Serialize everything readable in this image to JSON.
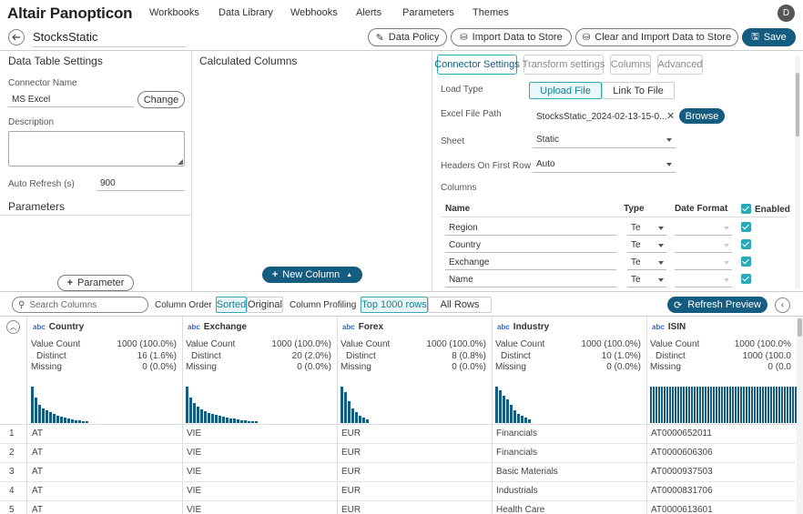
{
  "app": {
    "logo": "Altair Panopticon",
    "user_initial": "D"
  },
  "nav": [
    "Workbooks",
    "Data Library",
    "Webhooks",
    "Alerts",
    "Parameters",
    "Themes"
  ],
  "title": "StocksStatic",
  "actions": {
    "data_policy": "Data Policy",
    "import": "Import Data to Store",
    "clear_import": "Clear and Import Data to Store",
    "save": "Save"
  },
  "left": {
    "heading": "Data Table Settings",
    "connector_label": "Connector Name",
    "connector_value": "MS Excel",
    "change": "Change",
    "description_label": "Description",
    "autorefresh_label": "Auto Refresh (s)",
    "autorefresh_value": "900",
    "params_heading": "Parameters",
    "add_param": "Parameter"
  },
  "calc": {
    "heading": "Calculated Columns",
    "new_column": "New Column"
  },
  "right": {
    "tabs": [
      "Connector Settings",
      "Transform settings",
      "Columns",
      "Advanced"
    ],
    "load_type_label": "Load Type",
    "load_options": [
      "Upload File",
      "Link To File"
    ],
    "file_path_label": "Excel File Path",
    "file_path_value": "StocksStatic_2024-02-13-15-0...",
    "browse": "Browse",
    "sheet_label": "Sheet",
    "sheet_value": "Static",
    "headers_label": "Headers On First Row",
    "headers_value": "Auto",
    "columns_label": "Columns",
    "col_headers": {
      "name": "Name",
      "type": "Type",
      "date_format": "Date Format",
      "enabled": "Enabled"
    },
    "rows": [
      {
        "name": "Region",
        "type": "Te"
      },
      {
        "name": "Country",
        "type": "Te"
      },
      {
        "name": "Exchange",
        "type": "Te"
      },
      {
        "name": "Name",
        "type": "Te"
      }
    ]
  },
  "preview_bar": {
    "search_placeholder": "Search Columns",
    "order_label": "Column Order",
    "sorted": "Sorted",
    "original": "Original",
    "profiling_label": "Column Profiling",
    "top": "Top 1000 rows",
    "all": "All Rows",
    "refresh": "Refresh Preview"
  },
  "stat_labels": {
    "count": "Value Count",
    "distinct": "Distinct",
    "missing": "Missing"
  },
  "columns": [
    {
      "type": "abc",
      "name": "Country",
      "count": "1000 (100.0%)",
      "distinct": "16 (1.6%)",
      "missing": "0 (0.0%)",
      "hist": [
        40,
        28,
        20,
        16,
        14,
        12,
        10,
        8,
        7,
        6,
        5,
        4,
        3,
        3,
        2,
        2
      ]
    },
    {
      "type": "abc",
      "name": "Exchange",
      "count": "1000 (100.0%)",
      "distinct": "20 (2.0%)",
      "missing": "0 (0.0%)",
      "hist": [
        40,
        28,
        22,
        18,
        15,
        13,
        11,
        10,
        9,
        8,
        7,
        6,
        5,
        5,
        4,
        3,
        3,
        2,
        2,
        2
      ]
    },
    {
      "type": "abc",
      "name": "Forex",
      "count": "1000 (100.0%)",
      "distinct": "8 (0.8%)",
      "missing": "0 (0.0%)",
      "hist": [
        40,
        34,
        24,
        16,
        12,
        8,
        6,
        4
      ]
    },
    {
      "type": "abc",
      "name": "Industry",
      "count": "1000 (100.0%)",
      "distinct": "10 (1.0%)",
      "missing": "0 (0.0%)",
      "hist": [
        40,
        36,
        30,
        26,
        20,
        14,
        10,
        8,
        6,
        4
      ]
    },
    {
      "type": "abc",
      "name": "ISIN",
      "count": "1000 (100.0%",
      "distinct": "1000 (100.0",
      "missing": "0 (0.0",
      "hist": [
        40,
        40,
        40,
        40,
        40,
        40,
        40,
        40,
        40,
        40,
        40,
        40,
        40,
        40,
        40,
        40,
        40,
        40,
        40,
        40,
        40,
        40,
        40,
        40,
        40,
        40,
        40,
        40,
        40,
        40,
        40,
        40,
        40,
        40,
        40,
        40,
        40,
        40,
        40,
        40,
        40,
        40,
        40,
        40,
        40,
        40,
        40,
        40,
        40,
        40,
        40,
        40,
        40,
        40,
        40,
        40,
        40,
        40
      ]
    }
  ],
  "table_rows": [
    {
      "n": "1",
      "cells": [
        "AT",
        "VIE",
        "EUR",
        "Financials",
        "AT0000652011"
      ]
    },
    {
      "n": "2",
      "cells": [
        "AT",
        "VIE",
        "EUR",
        "Financials",
        "AT0000606306"
      ]
    },
    {
      "n": "3",
      "cells": [
        "AT",
        "VIE",
        "EUR",
        "Basic Materials",
        "AT0000937503"
      ]
    },
    {
      "n": "4",
      "cells": [
        "AT",
        "VIE",
        "EUR",
        "Industrials",
        "AT0000831706"
      ]
    },
    {
      "n": "5",
      "cells": [
        "AT",
        "VIE",
        "EUR",
        "Health Care",
        "AT0000613601"
      ]
    }
  ],
  "colors": {
    "brand": "#145c80",
    "accent": "#2aa9b8"
  }
}
